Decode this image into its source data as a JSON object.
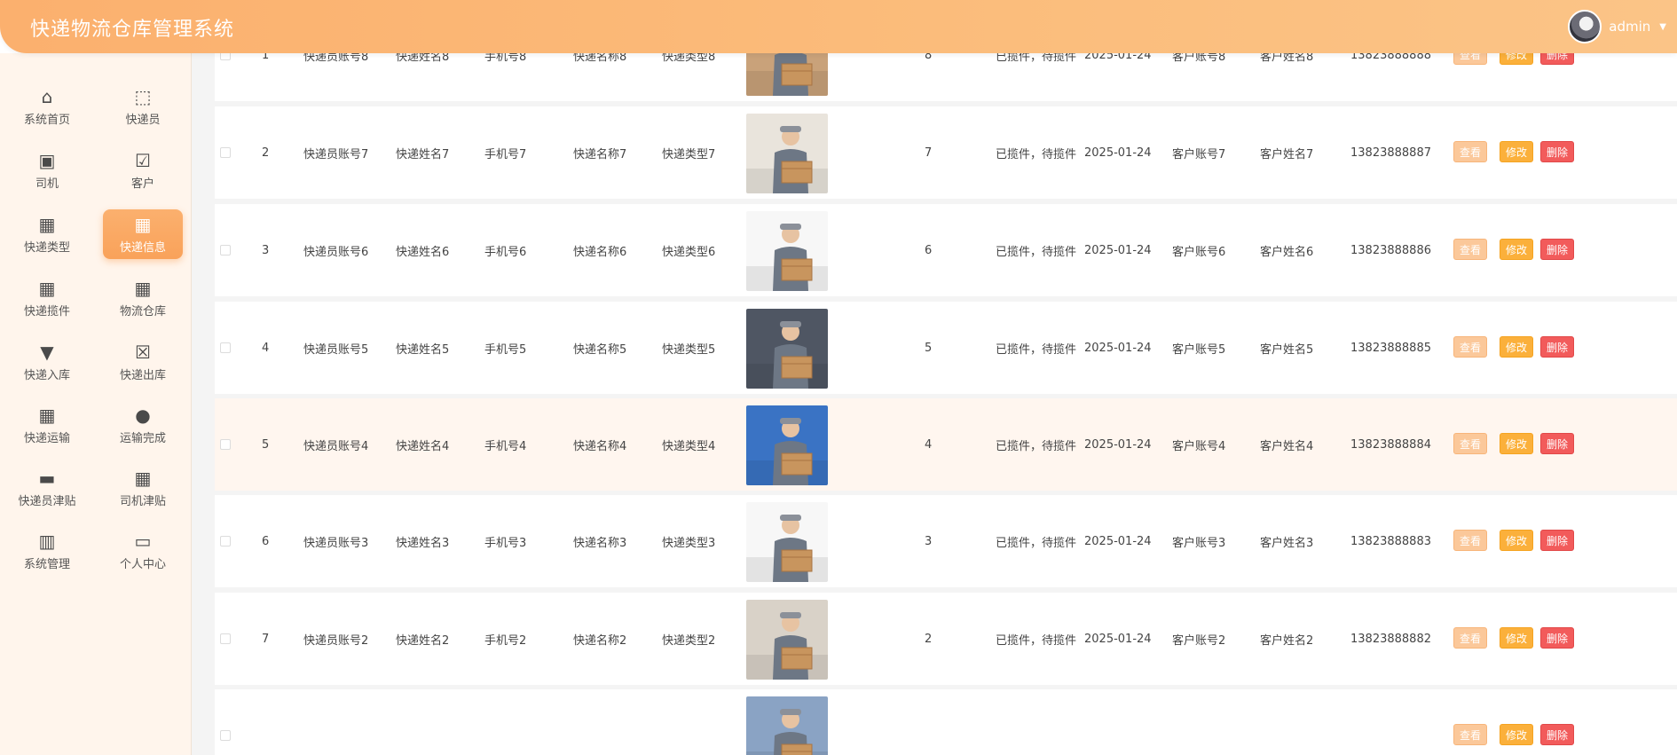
{
  "header": {
    "title": "快递物流仓库管理系统",
    "username": "admin"
  },
  "sidebar": {
    "items": [
      {
        "label": "系统首页",
        "icon": "home-icon",
        "glyph": "⌂"
      },
      {
        "label": "快递员",
        "icon": "chart-icon",
        "glyph": "⬚"
      },
      {
        "label": "司机",
        "icon": "clipboard-icon",
        "glyph": "▣"
      },
      {
        "label": "客户",
        "icon": "clipboard-check-icon",
        "glyph": "☑"
      },
      {
        "label": "快递类型",
        "icon": "grid-icon",
        "glyph": "▦"
      },
      {
        "label": "快递信息",
        "icon": "grid-icon",
        "glyph": "▦",
        "active": true
      },
      {
        "label": "快递揽件",
        "icon": "grid-icon",
        "glyph": "▦"
      },
      {
        "label": "物流仓库",
        "icon": "grid-icon",
        "glyph": "▦"
      },
      {
        "label": "快递入库",
        "icon": "brush-icon",
        "glyph": "▼"
      },
      {
        "label": "快递出库",
        "icon": "clipboard-x-icon",
        "glyph": "☒"
      },
      {
        "label": "快递运输",
        "icon": "grid-icon",
        "glyph": "▦"
      },
      {
        "label": "运输完成",
        "icon": "user-icon",
        "glyph": "●"
      },
      {
        "label": "快递员津贴",
        "icon": "briefcase-icon",
        "glyph": "▬"
      },
      {
        "label": "司机津贴",
        "icon": "grid-icon",
        "glyph": "▦"
      },
      {
        "label": "系统管理",
        "icon": "book-icon",
        "glyph": "▥"
      },
      {
        "label": "个人中心",
        "icon": "wallet-icon",
        "glyph": "▭"
      }
    ]
  },
  "colors": {
    "accent": "#fbb06e",
    "view_button": "#fbc89a",
    "edit_button": "#fbb03b",
    "delete_button": "#f25b5b"
  },
  "actions": {
    "view": "查看",
    "edit": "修改",
    "delete": "删除"
  },
  "rows": [
    {
      "index": "1",
      "courier_account": "快递员账号8",
      "courier_name": "快递姓名8",
      "phone": "手机号8",
      "express_name": "快递名称8",
      "express_type": "快递类型8",
      "quantity": "8",
      "status": "已揽件，待揽件",
      "date": "2025-01-24",
      "customer_account": "客户账号8",
      "customer_name": "客户姓名8",
      "customer_phone": "13823888888"
    },
    {
      "index": "2",
      "courier_account": "快递员账号7",
      "courier_name": "快递姓名7",
      "phone": "手机号7",
      "express_name": "快递名称7",
      "express_type": "快递类型7",
      "quantity": "7",
      "status": "已揽件，待揽件",
      "date": "2025-01-24",
      "customer_account": "客户账号7",
      "customer_name": "客户姓名7",
      "customer_phone": "13823888887"
    },
    {
      "index": "3",
      "courier_account": "快递员账号6",
      "courier_name": "快递姓名6",
      "phone": "手机号6",
      "express_name": "快递名称6",
      "express_type": "快递类型6",
      "quantity": "6",
      "status": "已揽件，待揽件",
      "date": "2025-01-24",
      "customer_account": "客户账号6",
      "customer_name": "客户姓名6",
      "customer_phone": "13823888886"
    },
    {
      "index": "4",
      "courier_account": "快递员账号5",
      "courier_name": "快递姓名5",
      "phone": "手机号5",
      "express_name": "快递名称5",
      "express_type": "快递类型5",
      "quantity": "5",
      "status": "已揽件，待揽件",
      "date": "2025-01-24",
      "customer_account": "客户账号5",
      "customer_name": "客户姓名5",
      "customer_phone": "13823888885"
    },
    {
      "index": "5",
      "courier_account": "快递员账号4",
      "courier_name": "快递姓名4",
      "phone": "手机号4",
      "express_name": "快递名称4",
      "express_type": "快递类型4",
      "quantity": "4",
      "status": "已揽件，待揽件",
      "date": "2025-01-24",
      "customer_account": "客户账号4",
      "customer_name": "客户姓名4",
      "customer_phone": "13823888884",
      "highlighted": true
    },
    {
      "index": "6",
      "courier_account": "快递员账号3",
      "courier_name": "快递姓名3",
      "phone": "手机号3",
      "express_name": "快递名称3",
      "express_type": "快递类型3",
      "quantity": "3",
      "status": "已揽件，待揽件",
      "date": "2025-01-24",
      "customer_account": "客户账号3",
      "customer_name": "客户姓名3",
      "customer_phone": "13823888883"
    },
    {
      "index": "7",
      "courier_account": "快递员账号2",
      "courier_name": "快递姓名2",
      "phone": "手机号2",
      "express_name": "快递名称2",
      "express_type": "快递类型2",
      "quantity": "2",
      "status": "已揽件，待揽件",
      "date": "2025-01-24",
      "customer_account": "客户账号2",
      "customer_name": "客户姓名2",
      "customer_phone": "13823888882"
    },
    {
      "index": "",
      "courier_account": "",
      "courier_name": "",
      "phone": "",
      "express_name": "",
      "express_type": "",
      "quantity": "",
      "status": "",
      "date": "",
      "customer_account": "",
      "customer_name": "",
      "customer_phone": ""
    }
  ]
}
